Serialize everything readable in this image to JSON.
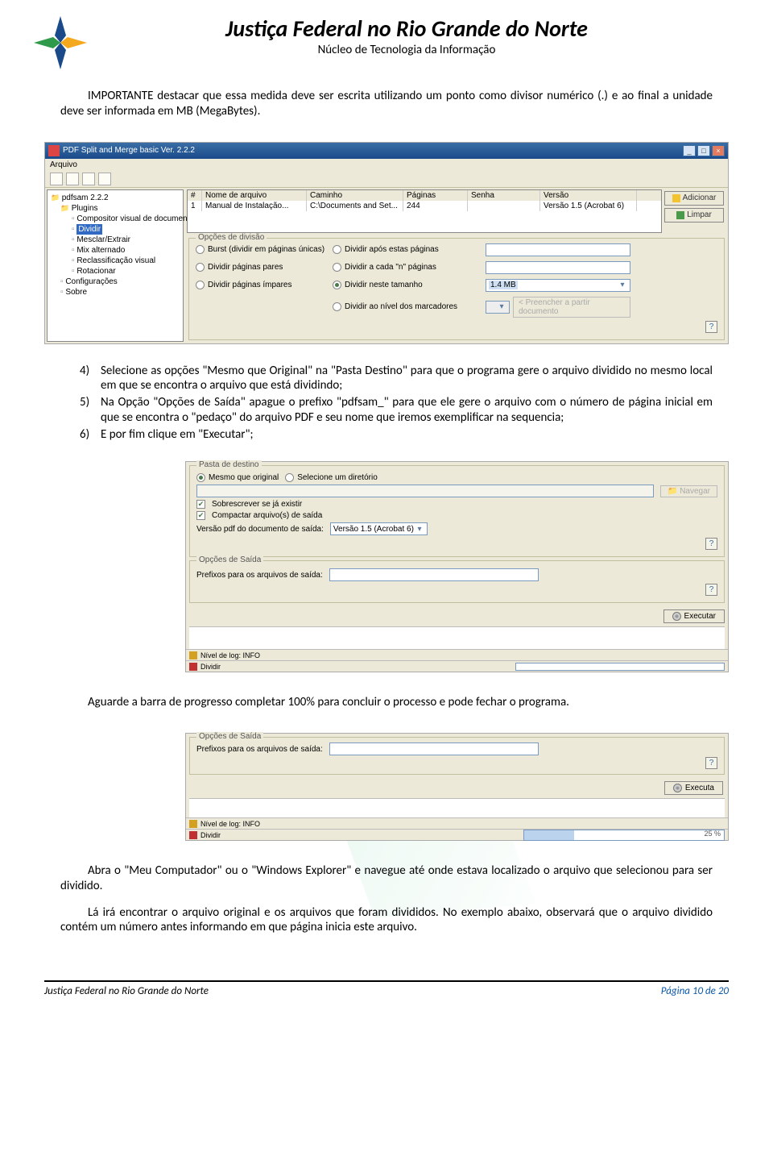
{
  "header": {
    "title": "Justiça Federal no Rio Grande do Norte",
    "subtitle": "Núcleo de Tecnologia da Informação"
  },
  "intro": "IMPORTANTE destacar que essa medida deve ser escrita utilizando um ponto como divisor numérico (.) e ao final a unidade deve ser informada em MB (MegaBytes).",
  "ss1": {
    "window_title": "PDF Split and Merge basic Ver. 2.2.2",
    "menu_arquivo": "Arquivo",
    "tree": {
      "root": "pdfsam 2.2.2",
      "plugins": "Plugins",
      "compositor": "Compositor visual de documento",
      "dividir": "Dividir",
      "mesclar": "Mesclar/Extrair",
      "mix": "Mix alternado",
      "reclass": "Reclassificação visual",
      "rotacionar": "Rotacionar",
      "config": "Configurações",
      "sobre": "Sobre"
    },
    "table": {
      "h_num": "#",
      "h_name": "Nome de arquivo",
      "h_path": "Caminho",
      "h_pag": "Páginas",
      "h_sen": "Senha",
      "h_ver": "Versão",
      "r_num": "1",
      "r_name": "Manual de Instalação...",
      "r_path": "C:\\Documents and Set...",
      "r_pag": "244",
      "r_sen": "",
      "r_ver": "Versão 1.5 (Acrobat 6)"
    },
    "btn_add": "Adicionar",
    "btn_clear": "Limpar",
    "gb_title": "Opções de divisão",
    "opt_burst": "Burst (dividir em páginas únicas)",
    "opt_pares": "Dividir páginas pares",
    "opt_impares": "Dividir páginas ímpares",
    "opt_apos": "Dividir após estas páginas",
    "opt_cada": "Dividir a cada \"n\" páginas",
    "opt_tam": "Dividir neste tamanho",
    "opt_marc": "Dividir ao nível dos marcadores",
    "size_value": "1.4 MB",
    "preencher": "< Preencher a partir documento"
  },
  "steps": {
    "n4": "4)",
    "t4": "Selecione as opções \"Mesmo que Original\" na \"Pasta Destino\" para que o programa gere o arquivo dividido no mesmo local em que se encontra o arquivo que está dividindo;",
    "n5": "5)",
    "t5": "Na Opção \"Opções de Saída\" apague o prefixo \"pdfsam_\" para que ele gere o arquivo com o número de página inicial em que se encontra o \"pedaço\" do arquivo PDF e seu nome que iremos exemplificar na sequencia;",
    "n6": "6)",
    "t6": "E por fim clique em \"Executar\";"
  },
  "ss2": {
    "gb_pasta": "Pasta de destino",
    "opt_mesmo": "Mesmo que original",
    "opt_selec": "Selecione um diretório",
    "btn_nav": "Navegar",
    "chk_sobr": "Sobrescrever se já existir",
    "chk_comp": "Compactar arquivo(s) de saída",
    "lbl_versao": "Versão pdf do documento de saída:",
    "versao_val": "Versão 1.5 (Acrobat 6)",
    "gb_saida": "Opções de Saída",
    "lbl_prefixo": "Prefixos para os arquivos de saída:",
    "btn_exec": "Executar",
    "status1": "Nível de log: INFO",
    "status2a": "Dividir"
  },
  "p_aguarde": "Aguarde a barra de progresso completar 100% para concluir o processo e pode fechar o programa.",
  "ss3": {
    "gb_saida": "Opções de Saída",
    "lbl_prefixo": "Prefixos para os arquivos de saída:",
    "btn_exec": "Executa",
    "status1": "Nível de log: INFO",
    "status2a": "Dividir",
    "progress_label": "25 %"
  },
  "p_abra": "Abra o \"Meu Computador\" ou o \"Windows Explorer\" e navegue até onde estava localizado o arquivo que selecionou para ser dividido.",
  "p_la": "Lá irá encontrar o arquivo original e os arquivos que foram divididos. No exemplo abaixo, observará que o arquivo dividido contém um número antes informando em que página inicia este arquivo.",
  "footer": {
    "left": "Justiça Federal no Rio Grande do Norte",
    "right": "Página 10 de 20"
  }
}
